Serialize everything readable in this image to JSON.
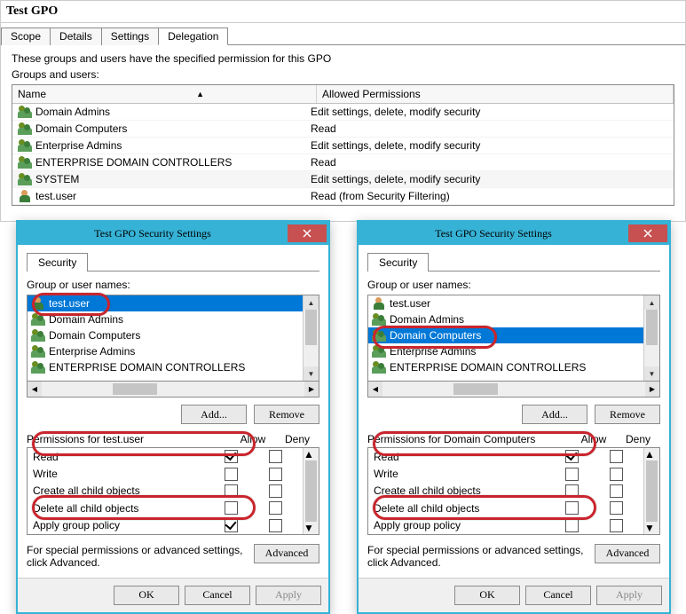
{
  "main": {
    "title": "Test GPO",
    "tabs": [
      "Scope",
      "Details",
      "Settings",
      "Delegation"
    ],
    "active_tab": 3,
    "description": "These groups and users have the specified permission for this GPO",
    "groups_label": "Groups and users:",
    "columns": {
      "name": "Name",
      "perm": "Allowed Permissions"
    },
    "rows": [
      {
        "icon": "group",
        "name": "Domain Admins",
        "perm": "Edit settings, delete, modify security"
      },
      {
        "icon": "group",
        "name": "Domain Computers",
        "perm": "Read"
      },
      {
        "icon": "group",
        "name": "Enterprise Admins",
        "perm": "Edit settings, delete, modify security"
      },
      {
        "icon": "group",
        "name": "ENTERPRISE DOMAIN CONTROLLERS",
        "perm": "Read"
      },
      {
        "icon": "group",
        "name": "SYSTEM",
        "perm": "Edit settings, delete, modify security",
        "alt": true
      },
      {
        "icon": "user",
        "name": "test.user",
        "perm": "Read (from Security Filtering)"
      }
    ]
  },
  "dialog_common": {
    "title": "Test GPO Security Settings",
    "tab": "Security",
    "group_label": "Group or user names:",
    "add": "Add...",
    "remove": "Remove",
    "allow": "Allow",
    "deny": "Deny",
    "advanced_text": "For special permissions or advanced settings, click Advanced.",
    "advanced": "Advanced",
    "ok": "OK",
    "cancel": "Cancel",
    "apply": "Apply",
    "perms": [
      "Read",
      "Write",
      "Create all child objects",
      "Delete all child objects",
      "Apply group policy"
    ]
  },
  "dlg_left": {
    "names": [
      {
        "icon": "user",
        "label": "test.user",
        "selected": true
      },
      {
        "icon": "group",
        "label": "Domain Admins"
      },
      {
        "icon": "group",
        "label": "Domain Computers"
      },
      {
        "icon": "group",
        "label": "Enterprise Admins"
      },
      {
        "icon": "group",
        "label": "ENTERPRISE DOMAIN CONTROLLERS"
      }
    ],
    "perm_for": "Permissions for test.user",
    "allow": {
      "Read": true,
      "Write": false,
      "Create all child objects": false,
      "Delete all child objects": false,
      "Apply group policy": true
    },
    "deny": {
      "Read": false,
      "Write": false,
      "Create all child objects": false,
      "Delete all child objects": false,
      "Apply group policy": false
    }
  },
  "dlg_right": {
    "names": [
      {
        "icon": "user",
        "label": "test.user"
      },
      {
        "icon": "group",
        "label": "Domain Admins"
      },
      {
        "icon": "group",
        "label": "Domain Computers",
        "selected": true
      },
      {
        "icon": "group",
        "label": "Enterprise Admins"
      },
      {
        "icon": "group",
        "label": "ENTERPRISE DOMAIN CONTROLLERS"
      }
    ],
    "perm_for": "Permissions for Domain Computers",
    "allow": {
      "Read": true,
      "Write": false,
      "Create all child objects": false,
      "Delete all child objects": false,
      "Apply group policy": false
    },
    "deny": {
      "Read": false,
      "Write": false,
      "Create all child objects": false,
      "Delete all child objects": false,
      "Apply group policy": false
    }
  }
}
